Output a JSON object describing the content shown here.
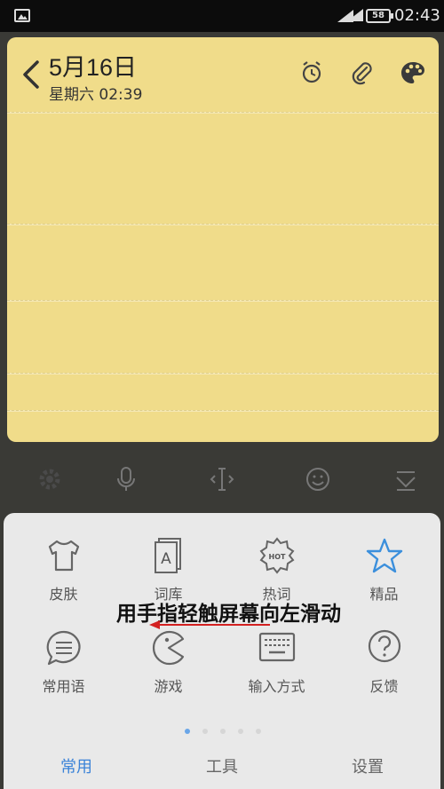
{
  "status_bar": {
    "battery": "58",
    "time": "02:43",
    "icons": [
      "image-icon",
      "signal-icon",
      "wifi-icon",
      "battery-icon"
    ]
  },
  "note": {
    "title": "5月16日",
    "subtitle": "星期六 02:39",
    "background": "#f0dc8a",
    "header_icons": [
      "alarm-icon",
      "attachment-icon",
      "palette-icon"
    ]
  },
  "toolbar": {
    "items": [
      "settings-icon",
      "microphone-icon",
      "cursor-move-icon",
      "emoji-icon",
      "keyboard-hide-icon"
    ]
  },
  "panel": {
    "items": [
      {
        "label": "皮肤",
        "icon": "shirt-icon"
      },
      {
        "label": "词库",
        "icon": "dictionary-icon"
      },
      {
        "label": "热词",
        "icon": "hot-badge-icon"
      },
      {
        "label": "精品",
        "icon": "star-icon"
      },
      {
        "label": "常用语",
        "icon": "chat-lines-icon"
      },
      {
        "label": "游戏",
        "icon": "pacman-icon"
      },
      {
        "label": "输入方式",
        "icon": "keyboard-icon"
      },
      {
        "label": "反馈",
        "icon": "question-icon"
      }
    ],
    "tabs": [
      {
        "label": "常用",
        "active": true
      },
      {
        "label": "工具",
        "active": false
      },
      {
        "label": "设置",
        "active": false
      }
    ],
    "accent": "#3b83d8"
  },
  "overlay": {
    "caption": "用手指轻触屏幕向左滑动",
    "arrow_color": "#d32020"
  }
}
